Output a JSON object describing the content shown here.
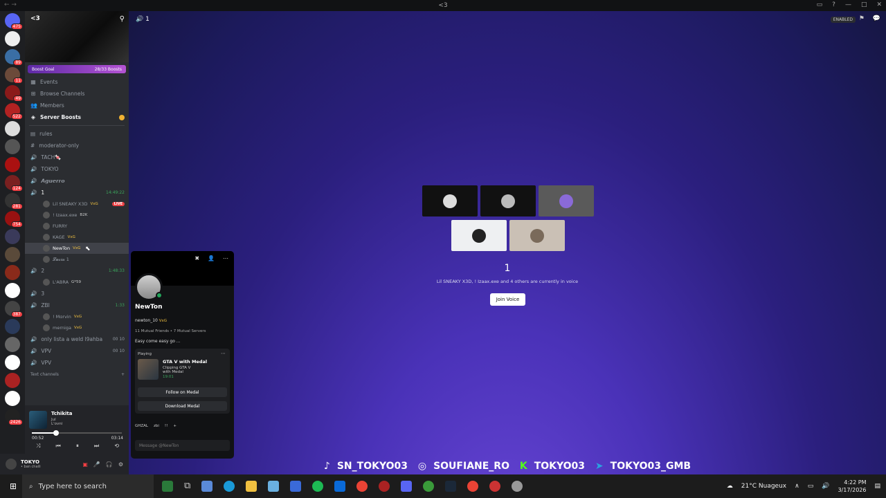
{
  "titlebar": {
    "center": "<3"
  },
  "guilds": [
    {
      "badge": "475",
      "color": "#5865f2"
    },
    {
      "badge": "",
      "color": "#eeeeee"
    },
    {
      "badge": "89",
      "color": "#3a6ea5"
    },
    {
      "badge": "11",
      "color": "#6b4a3a"
    },
    {
      "badge": "49",
      "color": "#8b1a1a"
    },
    {
      "badge": "522",
      "color": "#b22222"
    },
    {
      "badge": "",
      "color": "#dddddd"
    },
    {
      "badge": "",
      "color": "#555555"
    },
    {
      "badge": "",
      "color": "#aa1111"
    },
    {
      "badge": "124",
      "color": "#7a2020"
    },
    {
      "badge": "281",
      "color": "#333333"
    },
    {
      "badge": "754",
      "color": "#991111"
    },
    {
      "badge": "",
      "color": "#3a3a5a"
    },
    {
      "badge": "",
      "color": "#5a4a3a"
    },
    {
      "badge": "",
      "color": "#8a2a1a"
    },
    {
      "badge": "",
      "color": "#ffffff"
    },
    {
      "badge": "387",
      "color": "#444444"
    },
    {
      "badge": "",
      "color": "#2a3a5a"
    },
    {
      "badge": "",
      "color": "#666666"
    },
    {
      "badge": "",
      "color": "#ffffff"
    },
    {
      "badge": "",
      "color": "#aa2222"
    },
    {
      "badge": "",
      "color": "#ffffff"
    },
    {
      "badge": "2426",
      "color": "#222222"
    }
  ],
  "server": {
    "name": "<3",
    "boost_label": "Boost Goal",
    "boost_count": "28/33 Boosts"
  },
  "nav": {
    "events": "Events",
    "browse": "Browse Channels",
    "members": "Members",
    "boosts": "Server Boosts"
  },
  "channels": {
    "rules": "rules",
    "mod": "moderator-only",
    "tach": "TACH🍬",
    "tokyo": "TOKYO",
    "aguerro": "𝘼𝙜𝙪𝙚𝙧𝙧𝙤",
    "vc1": "1",
    "vc1_time": "14:49:22",
    "vc2": "2",
    "vc2_time": "1:48:33",
    "vc3": "3",
    "zbi": "ZBI",
    "zbi_time": "1:33",
    "only": "only lista a weld l9ahba",
    "only_count": "00 10",
    "vpv1": "VPV",
    "vpv1_count": "00 10",
    "vpv2": "VPV",
    "text_channels": "Text channels"
  },
  "voice_users": {
    "u1": "Lil SNEAKY X3D",
    "u1_tag": "VxG",
    "u1_live": "LIVE",
    "u2": "! Izaax.exe",
    "u2_tag": "B2K",
    "u3": "FURRY",
    "u4": "KAGE",
    "u4_tag": "VxG",
    "u5": "NewTon",
    "u5_tag": "VxG",
    "u6": "𝓛𝓾𝓬𝓲𝓪 1",
    "u7": "L'ABRA",
    "u7_tag": "G*59",
    "u8": "! Mɑrvin",
    "u8_tag": "VxG",
    "u9": "merniga",
    "u9_tag": "VxG"
  },
  "player": {
    "title": "Tchikita",
    "artist": "Jul",
    "album": "L'ovni",
    "elapsed": "00:52",
    "total": "03:14",
    "progress": 0.27
  },
  "user": {
    "name": "TOKYO",
    "status": "• ban chaili"
  },
  "stage": {
    "channel": "1",
    "enabled": "ENABLED",
    "title": "1",
    "subtitle": "Lil SNEAKY X3D, ! Izaax.exe and 4 others are currently in voice",
    "join": "Join Voice"
  },
  "socials": {
    "tiktok": "SN_TOKYO03",
    "instagram": "SOUFIANE_RO",
    "kick": "TOKYO03",
    "telegram": "TOKYO03_GMB"
  },
  "profile": {
    "name": "NewTon",
    "handle": "newton_10",
    "handle_tag": "VxG",
    "mutual": "11 Mutual Friends • 7 Mutual Servers",
    "bio": "Easy come easy go ...",
    "playing_label": "Playing",
    "game": "GTA V with Medal",
    "detail1": "Clipping GTA V",
    "detail2": "with Medal",
    "time": "19:01",
    "follow": "Follow on Medal",
    "download": "Download Medal",
    "roles": [
      "GHZAL",
      "zbi",
      "!!"
    ],
    "message_placeholder": "Message @NewTon"
  },
  "taskbar": {
    "search": "Type here to search",
    "weather": "21°C Nuageux",
    "time": "4:22 PM",
    "date": "3/17/2026"
  }
}
